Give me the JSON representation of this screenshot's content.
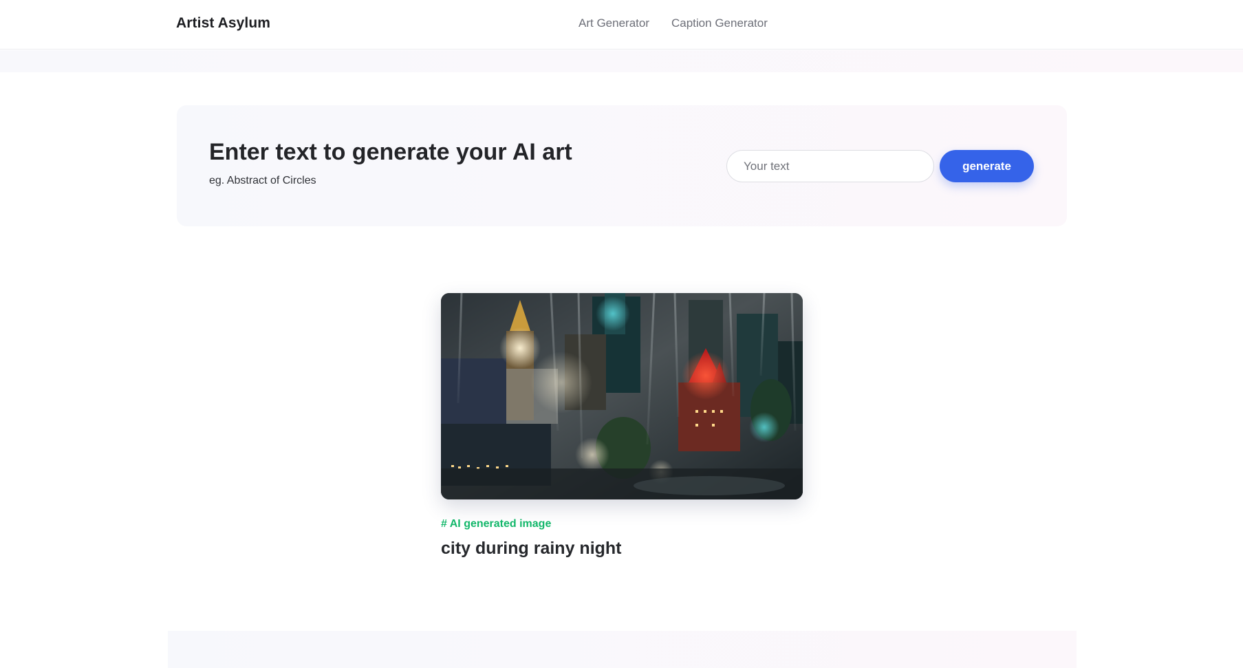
{
  "header": {
    "brand": "Artist Asylum",
    "nav": [
      {
        "label": "Art Generator"
      },
      {
        "label": "Caption Generator"
      }
    ]
  },
  "hero": {
    "title": "Enter text to generate your AI art",
    "subtitle": "eg. Abstract of Circles",
    "input_placeholder": "Your text",
    "input_value": "",
    "button_label": "generate"
  },
  "result": {
    "tag": "# AI generated image",
    "title": "city during rainy night",
    "image_alt": "city during rainy night"
  },
  "colors": {
    "accent": "#3563e9",
    "tag": "#12b76a",
    "text": "#232428"
  }
}
